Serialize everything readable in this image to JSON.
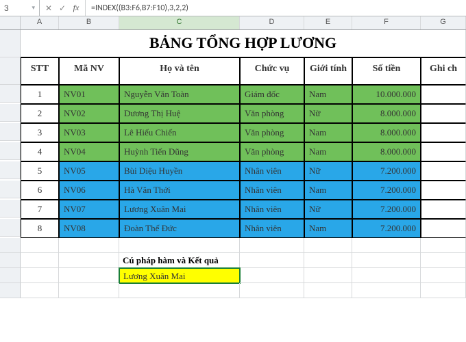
{
  "name_box": "3",
  "formula": "=INDEX((B3:F6,B7:F10),3,2,2)",
  "fx_label": "fx",
  "columns": [
    "A",
    "B",
    "C",
    "D",
    "E",
    "F",
    "G"
  ],
  "active_column": "C",
  "title": "BẢNG TỔNG HỢP LƯƠNG",
  "headers": {
    "stt": "STT",
    "ma_nv": "Mã NV",
    "ho_ten": "Họ và tên",
    "chuc_vu": "Chức vụ",
    "gioi_tinh": "Giới tính",
    "so_tien": "Số tiền",
    "ghi_chu": "Ghi ch"
  },
  "rows": [
    {
      "stt": "1",
      "ma": "NV01",
      "ten": "Nguyễn Văn Toàn",
      "cv": "Giám đốc",
      "gt": "Nam",
      "tien": "10.000.000",
      "fill": "green"
    },
    {
      "stt": "2",
      "ma": "NV02",
      "ten": "Dương Thị Huệ",
      "cv": "Văn phòng",
      "gt": "Nữ",
      "tien": "8.000.000",
      "fill": "green"
    },
    {
      "stt": "3",
      "ma": "NV03",
      "ten": "Lê Hiếu Chiến",
      "cv": "Văn phòng",
      "gt": "Nam",
      "tien": "8.000.000",
      "fill": "green"
    },
    {
      "stt": "4",
      "ma": "NV04",
      "ten": "Huỳnh Tiến Dũng",
      "cv": "Văn phòng",
      "gt": "Nam",
      "tien": "8.000.000",
      "fill": "green"
    },
    {
      "stt": "5",
      "ma": "NV05",
      "ten": "Bùi Diệu Huyền",
      "cv": "Nhân viên",
      "gt": "Nữ",
      "tien": "7.200.000",
      "fill": "blue"
    },
    {
      "stt": "6",
      "ma": "NV06",
      "ten": "Hà Văn Thới",
      "cv": "Nhân viên",
      "gt": "Nam",
      "tien": "7.200.000",
      "fill": "blue"
    },
    {
      "stt": "7",
      "ma": "NV07",
      "ten": "Lương Xuân Mai",
      "cv": "Nhân viên",
      "gt": "Nữ",
      "tien": "7.200.000",
      "fill": "blue"
    },
    {
      "stt": "8",
      "ma": "NV08",
      "ten": "Đoàn Thế Đức",
      "cv": "Nhân viên",
      "gt": "Nam",
      "tien": "7.200.000",
      "fill": "blue"
    }
  ],
  "syntax_label": "Cú pháp hàm và Kết quả",
  "result_value": "Lương Xuân Mai",
  "icons": {
    "cancel": "✕",
    "enter": "✓",
    "dropdown": "▾"
  }
}
